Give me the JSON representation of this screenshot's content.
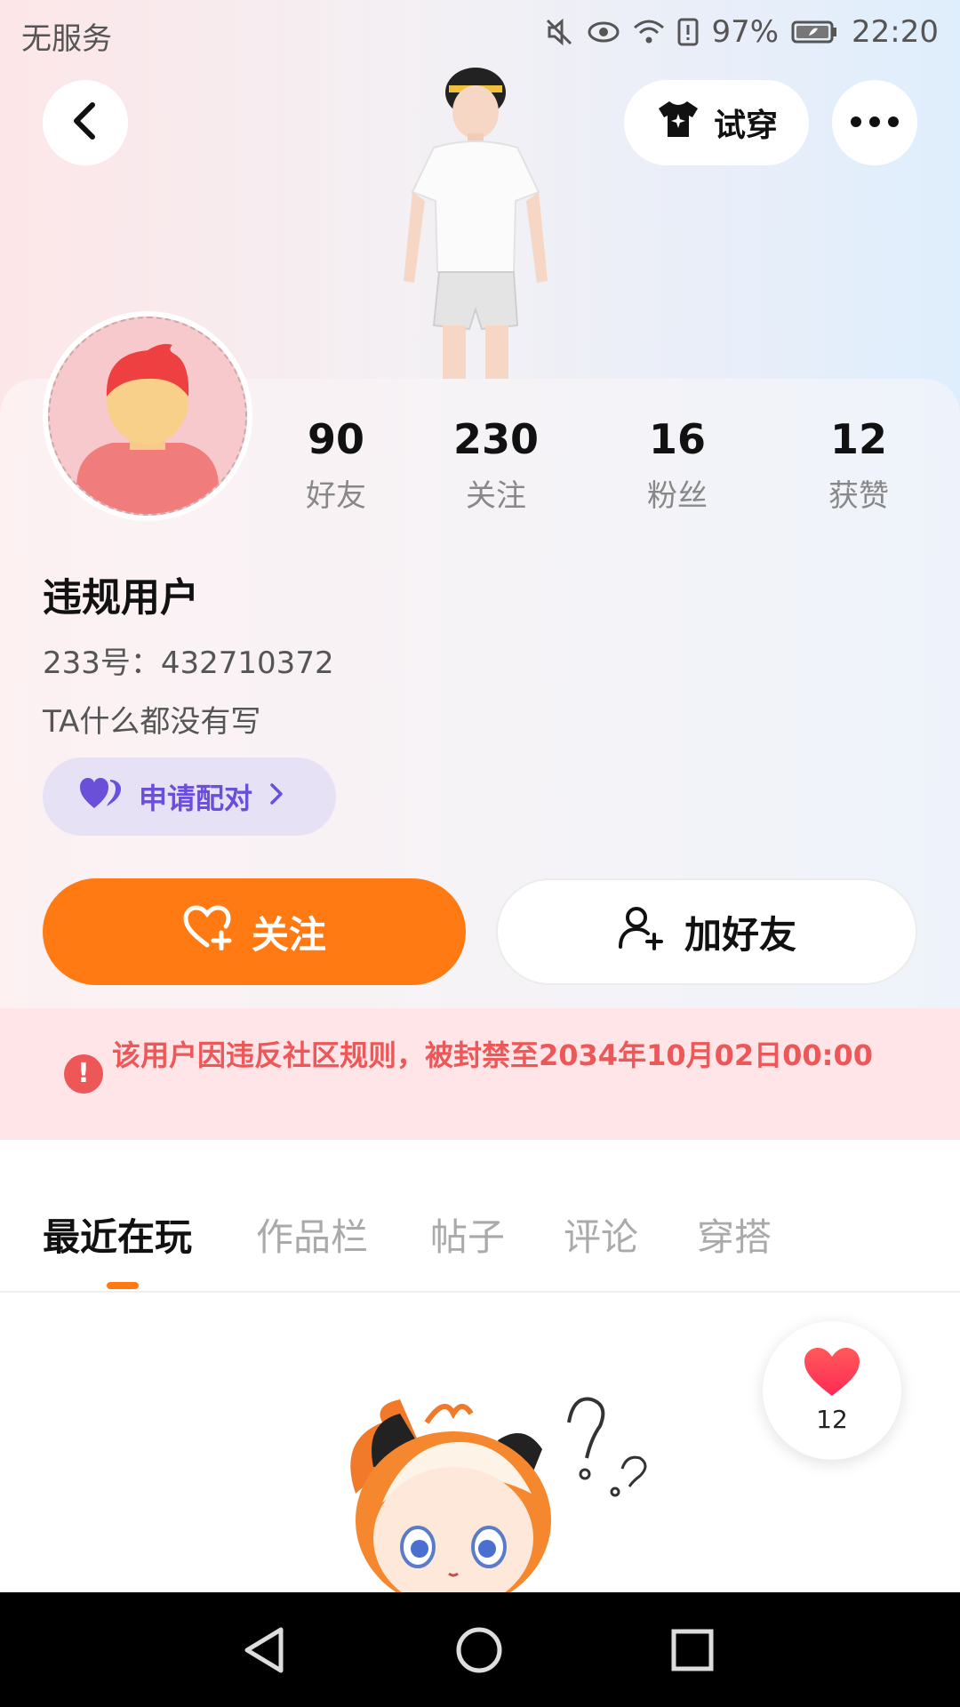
{
  "status_bar": {
    "carrier": "无服务",
    "battery": "97%",
    "time": "22:20"
  },
  "header": {
    "try_on_label": "试穿"
  },
  "profile": {
    "stats": [
      {
        "value": "90",
        "label": "好友"
      },
      {
        "value": "230",
        "label": "关注"
      },
      {
        "value": "16",
        "label": "粉丝"
      },
      {
        "value": "12",
        "label": "获赞"
      }
    ],
    "username": "违规用户",
    "uid": "233号：432710372",
    "bio": "TA什么都没有写",
    "pair_label": "申请配对",
    "follow_label": "关注",
    "add_friend_label": "加好友"
  },
  "ban_notice": {
    "text": "该用户因违反社区规则，被封禁至2034年10月02日00:00"
  },
  "tabs": [
    {
      "label": "最近在玩",
      "active": true
    },
    {
      "label": "作品栏",
      "active": false
    },
    {
      "label": "帖子",
      "active": false
    },
    {
      "label": "评论",
      "active": false
    },
    {
      "label": "穿搭",
      "active": false
    }
  ],
  "like_badge": {
    "count": "12"
  },
  "colors": {
    "accent": "#ff7a13",
    "ban_red": "#ee5757",
    "pair_purple": "#6a4fd8"
  }
}
